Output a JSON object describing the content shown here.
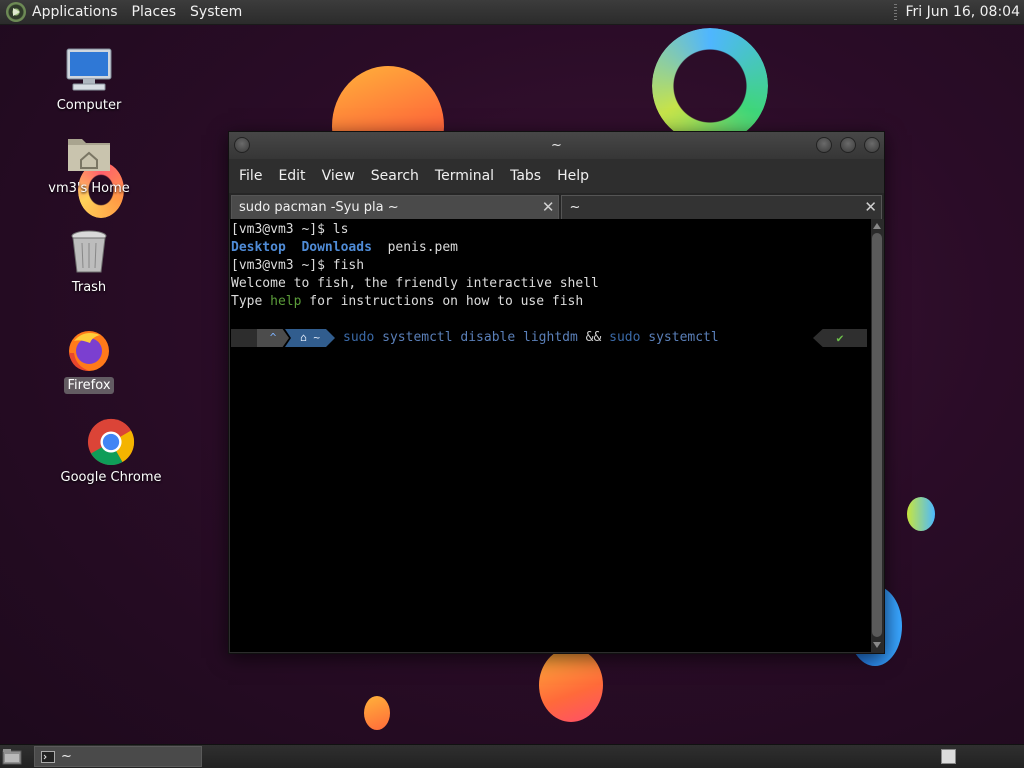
{
  "top_panel": {
    "menus": [
      "Applications",
      "Places",
      "System"
    ],
    "clock": "Fri Jun 16, 08:04"
  },
  "desktop": {
    "icons": [
      {
        "label": "Computer",
        "icon": "computer-icon"
      },
      {
        "label": "vm3's Home",
        "icon": "home-folder-icon"
      },
      {
        "label": "Trash",
        "icon": "trash-icon"
      },
      {
        "label": "Firefox",
        "icon": "firefox-icon"
      },
      {
        "label": "Google Chrome",
        "icon": "chrome-icon"
      }
    ]
  },
  "terminal": {
    "title": "~",
    "menu": [
      "File",
      "Edit",
      "View",
      "Search",
      "Terminal",
      "Tabs",
      "Help"
    ],
    "tabs": [
      {
        "label": "sudo pacman -Syu pla ~",
        "active": true
      },
      {
        "label": "~",
        "active": false
      }
    ],
    "lines": {
      "l1": "[vm3@vm3 ~]$ ls",
      "l2_dir1": "Desktop",
      "l2_dir2": "Downloads",
      "l2_file": "penis.pem",
      "l3": "[vm3@vm3 ~]$ fish",
      "l4": "Welcome to fish, the friendly interactive shell",
      "l5_a": "Type ",
      "l5_help": "help",
      "l5_b": " for instructions on how to use fish"
    },
    "prompt": {
      "seg_caret": "^",
      "seg_home": "~",
      "cmd_sudo1": "sudo",
      "cmd_main": " systemctl disable lightdm ",
      "cmd_amp": "&&",
      "cmd_sudo2": " sudo",
      "cmd_tail": " systemctl",
      "status": "✔"
    }
  },
  "bottom_panel": {
    "task_label": "~"
  },
  "colors": {
    "dir": "#4f8bd6",
    "help": "#5b9c3a",
    "status_ok": "#6cc04a"
  }
}
